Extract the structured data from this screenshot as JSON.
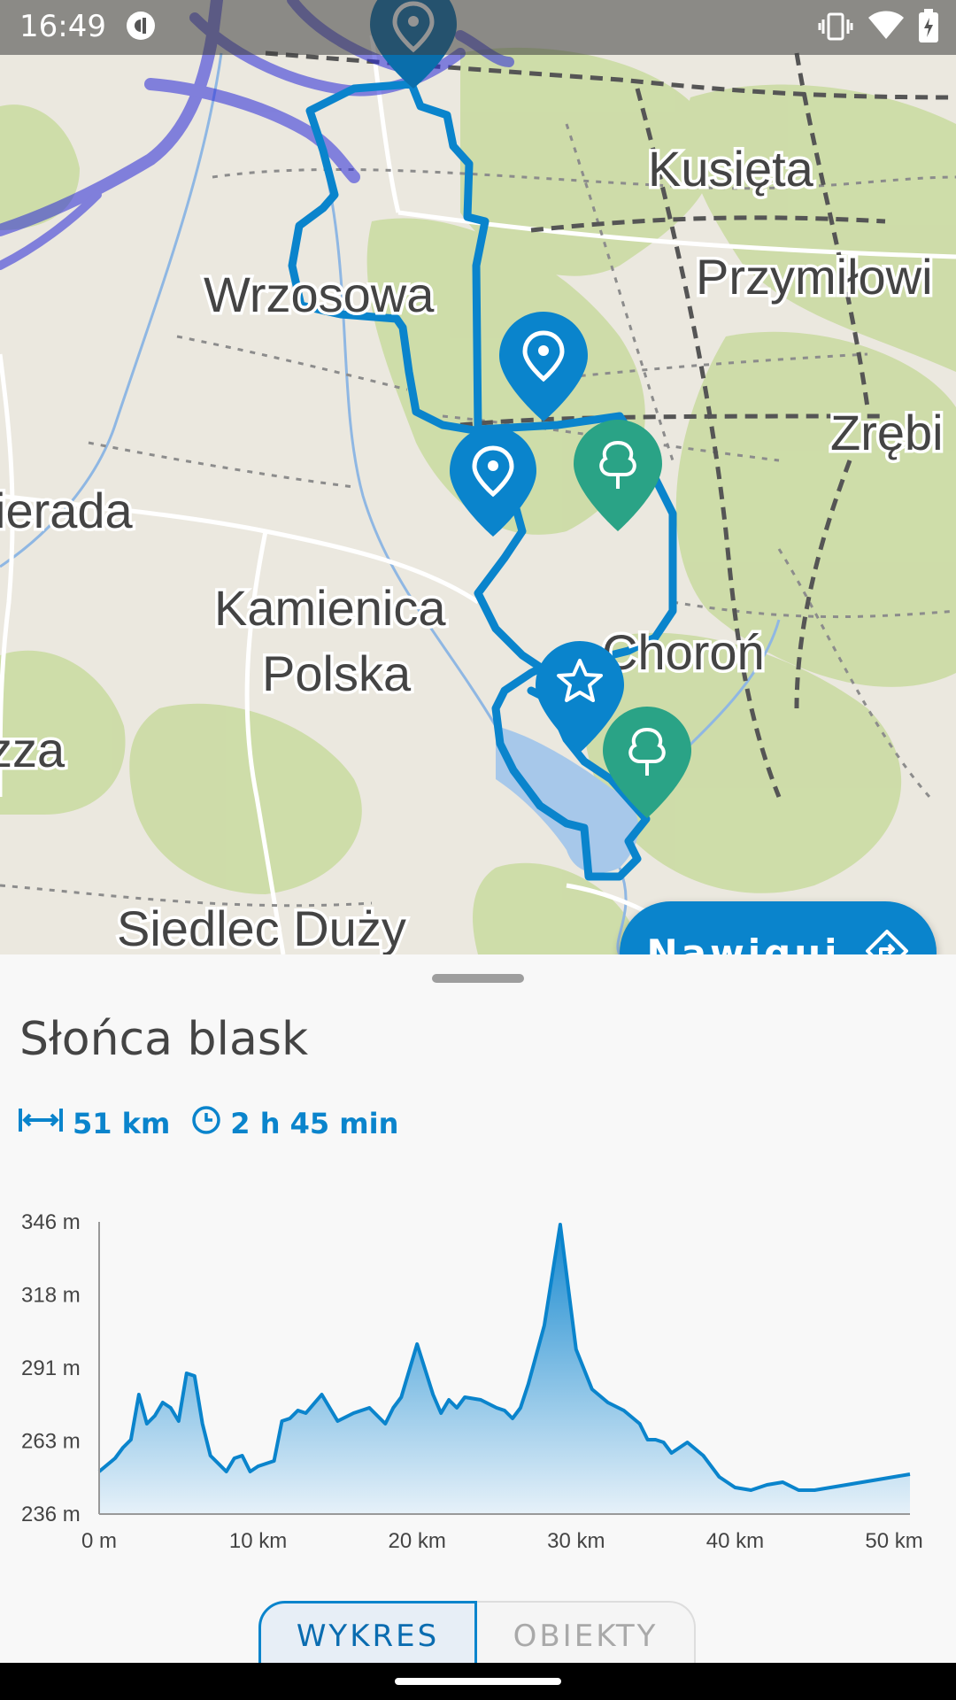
{
  "status_bar": {
    "time": "16:49",
    "icons": [
      "sync-icon",
      "vibrate-icon",
      "wifi-icon",
      "battery-charging-icon"
    ]
  },
  "map": {
    "labels": [
      "Kusięta",
      "Przymiłowi",
      "Wrzosowa",
      "Zrębi",
      "ierada",
      "Kamienica",
      "Polska",
      "Choroń",
      "zza",
      "Siedlec Duży"
    ],
    "colors": {
      "route": "#0a84cc",
      "park_marker": "#2aa386",
      "poi_marker": "#0a84cc",
      "other_routes": "#2a2ad8"
    }
  },
  "navigate_button": {
    "label": "Nawiguj",
    "icon": "route-diamond-icon"
  },
  "route": {
    "name": "Słońca blask",
    "distance": "51 km",
    "duration": "2 h 45 min",
    "accent": "#0a84cc"
  },
  "chart_data": {
    "type": "area",
    "title": "",
    "xlabel": "",
    "ylabel": "",
    "x_tick_labels": [
      "0 m",
      "10 km",
      "20 km",
      "30 km",
      "40 km",
      "50 km"
    ],
    "y_tick_labels": [
      "346 m",
      "318 m",
      "291 m",
      "263 m",
      "236 m"
    ],
    "xlim": [
      0,
      51
    ],
    "ylim": [
      236,
      346
    ],
    "series": [
      {
        "x": [
          0,
          1,
          1.5,
          2,
          2.5,
          3,
          3.5,
          4,
          4.5,
          5,
          5.5,
          6,
          6.5,
          7,
          8,
          8.5,
          9,
          9.5,
          10,
          11,
          11.5,
          12,
          12.5,
          13,
          14,
          15,
          16,
          17,
          18,
          18.5,
          19,
          20,
          21,
          21.5,
          22,
          22.5,
          23,
          24,
          25,
          25.5,
          26,
          26.5,
          27,
          28,
          29,
          30,
          31,
          32,
          33,
          34,
          34.5,
          35,
          35.5,
          36,
          37,
          38,
          39,
          40,
          41,
          42,
          43,
          44,
          45,
          46,
          47,
          48,
          49,
          50,
          51
        ],
        "y": [
          252,
          257,
          261,
          264,
          281,
          270,
          273,
          278,
          276,
          271,
          289,
          288,
          270,
          258,
          252,
          257,
          258,
          252,
          254,
          256,
          271,
          272,
          275,
          274,
          281,
          271,
          274,
          276,
          270,
          276,
          280,
          300,
          281,
          274,
          279,
          276,
          280,
          279,
          276,
          275,
          272,
          276,
          285,
          307,
          345,
          298,
          283,
          278,
          275,
          270,
          264,
          264,
          263,
          259,
          263,
          258,
          250,
          246,
          245,
          247,
          248,
          245,
          245,
          246,
          247,
          248,
          249,
          250,
          251
        ]
      }
    ]
  },
  "tabs": {
    "chart": "WYKRES",
    "objects": "OBIEKTY"
  }
}
